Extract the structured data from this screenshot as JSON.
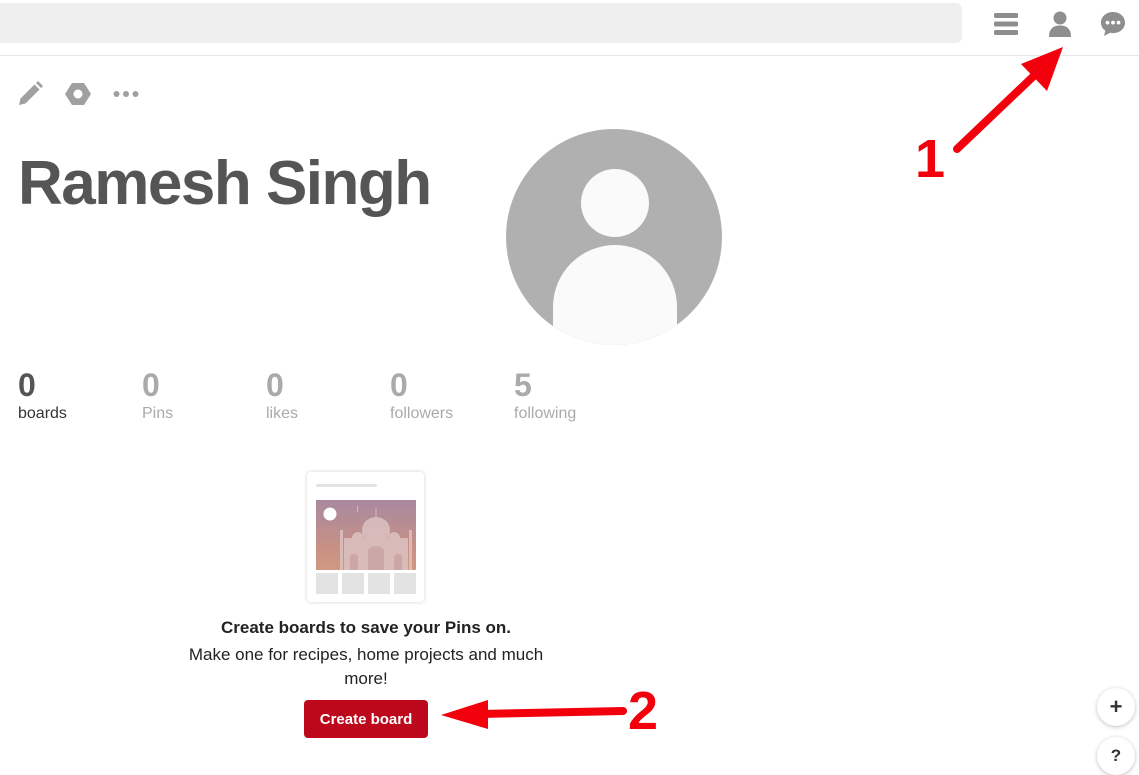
{
  "header": {
    "search": {
      "placeholder": ""
    },
    "icons": [
      "menu-icon",
      "profile-icon",
      "messages-icon"
    ]
  },
  "toolbar": {
    "icons": [
      "edit-pencil-icon",
      "settings-hexagon-icon",
      "more-options-icon"
    ]
  },
  "profile": {
    "name": "Ramesh Singh",
    "avatar_icon": "default-avatar-icon"
  },
  "stats": [
    {
      "value": "0",
      "label": "boards",
      "active": true
    },
    {
      "value": "0",
      "label": "Pins",
      "active": false
    },
    {
      "value": "0",
      "label": "likes",
      "active": false
    },
    {
      "value": "0",
      "label": "followers",
      "active": false
    },
    {
      "value": "5",
      "label": "following",
      "active": false
    }
  ],
  "empty_state": {
    "title": "Create boards to save your Pins on.",
    "description": "Make one for recipes, home projects and much more!",
    "button_label": "Create board",
    "illustration_icon": "taj-mahal-board-illustration"
  },
  "floating": {
    "add_label": "+",
    "help_label": "?"
  },
  "annotations": {
    "marker_1": "1",
    "marker_2": "2",
    "color": "#f2000c"
  },
  "colors": {
    "brand": "#bd081c",
    "icon_gray": "#8e8e8e",
    "name_text": "#555555"
  }
}
